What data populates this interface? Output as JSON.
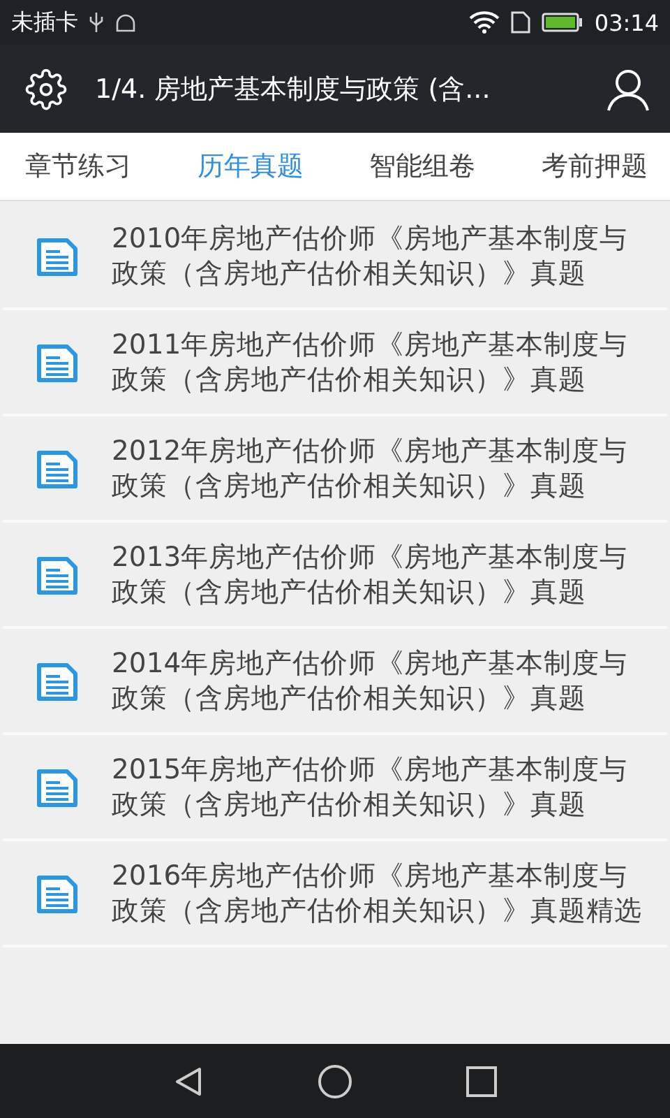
{
  "status_bar": {
    "carrier": "未插卡",
    "time": "03:14"
  },
  "header": {
    "title": "1/4. 房地产基本制度与政策 (含..."
  },
  "tabs": [
    {
      "label": "章节练习",
      "selected": false
    },
    {
      "label": "历年真题",
      "selected": true
    },
    {
      "label": "智能组卷",
      "selected": false
    },
    {
      "label": "考前押题",
      "selected": false
    }
  ],
  "items": [
    {
      "title": "2010年房地产估价师《房地产基本制度与政策（含房地产估价相关知识）》真题"
    },
    {
      "title": "2011年房地产估价师《房地产基本制度与政策（含房地产估价相关知识）》真题"
    },
    {
      "title": "2012年房地产估价师《房地产基本制度与政策（含房地产估价相关知识）》真题"
    },
    {
      "title": "2013年房地产估价师《房地产基本制度与政策（含房地产估价相关知识）》真题"
    },
    {
      "title": "2014年房地产估价师《房地产基本制度与政策（含房地产估价相关知识）》真题"
    },
    {
      "title": "2015年房地产估价师《房地产基本制度与政策（含房地产估价相关知识）》真题"
    },
    {
      "title": "2016年房地产估价师《房地产基本制度与政策（含房地产估价相关知识）》真题精选"
    }
  ]
}
